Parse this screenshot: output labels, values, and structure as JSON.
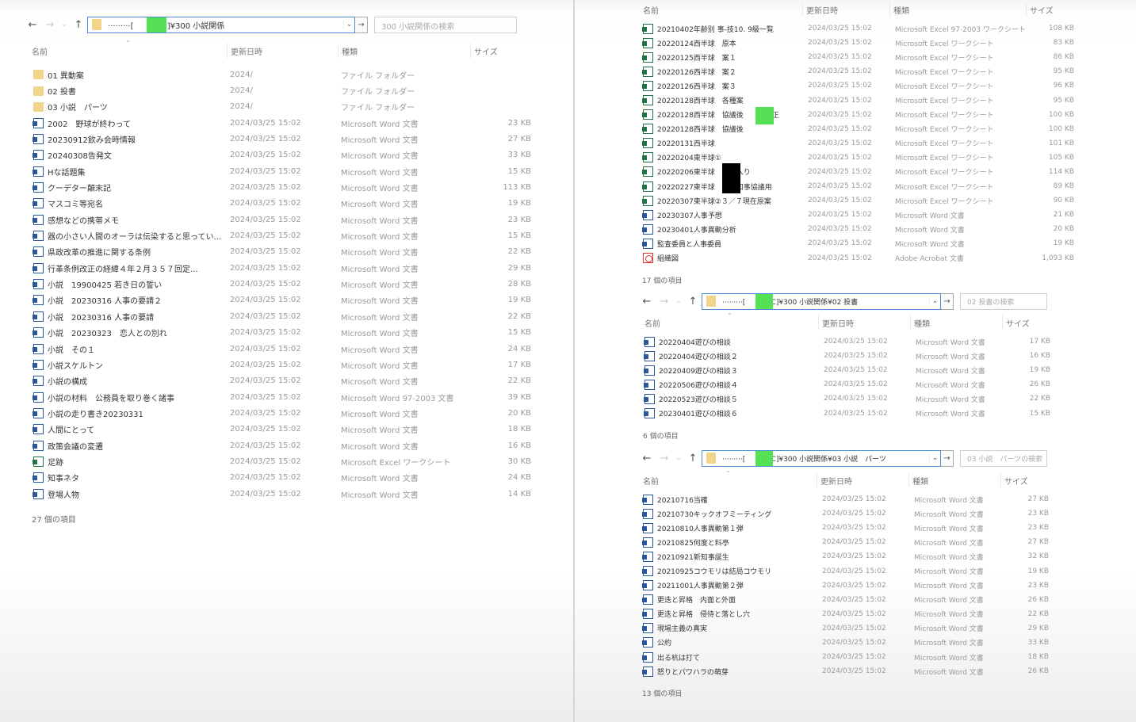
{
  "left": {
    "path_prefix": "·········[",
    "path": "P C]¥300 小説関係",
    "search_placeholder": "300 小説関係の検索",
    "headers": {
      "name": "名前",
      "date": "更新日時",
      "type": "種類",
      "size": "サイズ"
    },
    "rows": [
      {
        "icon": "folder",
        "name": "01 異動案",
        "date": "2024/",
        "type": "ファイル フォルダー",
        "size": ""
      },
      {
        "icon": "folder",
        "name": "02 投書",
        "date": "2024/",
        "type": "ファイル フォルダー",
        "size": ""
      },
      {
        "icon": "folder",
        "name": "03 小説　パーツ",
        "date": "2024/",
        "type": "ファイル フォルダー",
        "size": ""
      },
      {
        "icon": "word",
        "name": "2002　野球が終わって",
        "date": "2024/03/25 15:02",
        "type": "Microsoft Word 文書",
        "size": "23 KB"
      },
      {
        "icon": "word",
        "name": "20230912飲み会時情報",
        "date": "2024/03/25 15:02",
        "type": "Microsoft Word 文書",
        "size": "27 KB"
      },
      {
        "icon": "word",
        "name": "20240308告発文",
        "date": "2024/03/25 15:02",
        "type": "Microsoft Word 文書",
        "size": "33 KB"
      },
      {
        "icon": "word",
        "name": "Hな話題集",
        "date": "2024/03/25 15:02",
        "type": "Microsoft Word 文書",
        "size": "15 KB"
      },
      {
        "icon": "word",
        "name": "クーデター顛末記",
        "date": "2024/03/25 15:02",
        "type": "Microsoft Word 文書",
        "size": "113 KB"
      },
      {
        "icon": "word",
        "name": "マスコミ等宛名",
        "date": "2024/03/25 15:02",
        "type": "Microsoft Word 文書",
        "size": "19 KB"
      },
      {
        "icon": "word",
        "name": "感想などの携帯メモ",
        "date": "2024/03/25 15:02",
        "type": "Microsoft Word 文書",
        "size": "23 KB"
      },
      {
        "icon": "word",
        "name": "器の小さい人間のオーラは伝染すると思ってい...",
        "date": "2024/03/25 15:02",
        "type": "Microsoft Word 文書",
        "size": "15 KB"
      },
      {
        "icon": "word",
        "name": "県政改革の推進に関する条例",
        "date": "2024/03/25 15:02",
        "type": "Microsoft Word 文書",
        "size": "22 KB"
      },
      {
        "icon": "word",
        "name": "行革条例改正の経緯４年２月３５７回定...",
        "date": "2024/03/25 15:02",
        "type": "Microsoft Word 文書",
        "size": "29 KB"
      },
      {
        "icon": "word",
        "name": "小説　19900425 若き日の誓い",
        "date": "2024/03/25 15:02",
        "type": "Microsoft Word 文書",
        "size": "28 KB"
      },
      {
        "icon": "word",
        "name": "小説　20230316 人事の要請２",
        "date": "2024/03/25 15:02",
        "type": "Microsoft Word 文書",
        "size": "19 KB"
      },
      {
        "icon": "word",
        "name": "小説　20230316 人事の要請",
        "date": "2024/03/25 15:02",
        "type": "Microsoft Word 文書",
        "size": "22 KB"
      },
      {
        "icon": "word",
        "name": "小説　20230323　恋人との別れ",
        "date": "2024/03/25 15:02",
        "type": "Microsoft Word 文書",
        "size": "15 KB"
      },
      {
        "icon": "word",
        "name": "小説　その１",
        "date": "2024/03/25 15:02",
        "type": "Microsoft Word 文書",
        "size": "24 KB"
      },
      {
        "icon": "word",
        "name": "小説スケルトン",
        "date": "2024/03/25 15:02",
        "type": "Microsoft Word 文書",
        "size": "17 KB"
      },
      {
        "icon": "word",
        "name": "小説の構成",
        "date": "2024/03/25 15:02",
        "type": "Microsoft Word 文書",
        "size": "22 KB"
      },
      {
        "icon": "word",
        "name": "小説の材料　公務員を取り巻く諸事",
        "date": "2024/03/25 15:02",
        "type": "Microsoft Word 97-2003 文書",
        "size": "39 KB"
      },
      {
        "icon": "word",
        "name": "小説の走り書き20230331",
        "date": "2024/03/25 15:02",
        "type": "Microsoft Word 文書",
        "size": "20 KB"
      },
      {
        "icon": "word",
        "name": "人間にとって",
        "date": "2024/03/25 15:02",
        "type": "Microsoft Word 文書",
        "size": "18 KB"
      },
      {
        "icon": "word",
        "name": "政策会議の変遷",
        "date": "2024/03/25 15:02",
        "type": "Microsoft Word 文書",
        "size": "16 KB"
      },
      {
        "icon": "excel",
        "name": "足跡",
        "date": "2024/03/25 15:02",
        "type": "Microsoft Excel ワークシート",
        "size": "30 KB"
      },
      {
        "icon": "word",
        "name": "知事ネタ",
        "date": "2024/03/25 15:02",
        "type": "Microsoft Word 文書",
        "size": "24 KB"
      },
      {
        "icon": "word",
        "name": "登場人物",
        "date": "2024/03/25 15:02",
        "type": "Microsoft Word 文書",
        "size": "14 KB"
      }
    ],
    "count": "27 個の項目"
  },
  "r1": {
    "headers": {
      "name": "名前",
      "date": "更新日時",
      "type": "種類",
      "size": "サイズ"
    },
    "rows": [
      {
        "icon": "excel",
        "name": "20210402年齢別 事-技10. 9級一覧",
        "date": "2024/03/25 15:02",
        "type": "Microsoft Excel 97-2003 ワークシート",
        "size": "108 KB"
      },
      {
        "icon": "excel",
        "name": "20220124西半球　原本",
        "date": "2024/03/25 15:02",
        "type": "Microsoft Excel ワークシート",
        "size": "83 KB"
      },
      {
        "icon": "excel",
        "name": "20220125西半球　案１",
        "date": "2024/03/25 15:02",
        "type": "Microsoft Excel ワークシート",
        "size": "86 KB"
      },
      {
        "icon": "excel",
        "name": "20220126西半球　案２",
        "date": "2024/03/25 15:02",
        "type": "Microsoft Excel ワークシート",
        "size": "95 KB"
      },
      {
        "icon": "excel",
        "name": "20220126西半球　案３",
        "date": "2024/03/25 15:02",
        "type": "Microsoft Excel ワークシート",
        "size": "96 KB"
      },
      {
        "icon": "excel",
        "name": "20220128西半球　各種案",
        "date": "2024/03/25 15:02",
        "type": "Microsoft Excel ワークシート",
        "size": "95 KB"
      },
      {
        "icon": "excel",
        "name": "20220128西半球　協議後　　　修正",
        "date": "2024/03/25 15:02",
        "type": "Microsoft Excel ワークシート",
        "size": "100 KB"
      },
      {
        "icon": "excel",
        "name": "20220128西半球　協議後",
        "date": "2024/03/25 15:02",
        "type": "Microsoft Excel ワークシート",
        "size": "100 KB"
      },
      {
        "icon": "excel",
        "name": "20220131西半球",
        "date": "2024/03/25 15:02",
        "type": "Microsoft Excel ワークシート",
        "size": "101 KB"
      },
      {
        "icon": "excel",
        "name": "20220204東半球①",
        "date": "2024/03/25 15:02",
        "type": "Microsoft Excel ワークシート",
        "size": "105 KB"
      },
      {
        "icon": "excel",
        "name": "20220206東半球　　案入り",
        "date": "2024/03/25 15:02",
        "type": "Microsoft Excel ワークシート",
        "size": "114 KB"
      },
      {
        "icon": "excel",
        "name": "20220227東半球　　案知事協議用",
        "date": "2024/03/25 15:02",
        "type": "Microsoft Excel ワークシート",
        "size": "89 KB"
      },
      {
        "icon": "excel",
        "name": "20220307東半球②３／７現在原案",
        "date": "2024/03/25 15:02",
        "type": "Microsoft Excel ワークシート",
        "size": "90 KB"
      },
      {
        "icon": "word",
        "name": "20230307人事予想",
        "date": "2024/03/25 15:02",
        "type": "Microsoft Word 文書",
        "size": "21 KB"
      },
      {
        "icon": "word",
        "name": "20230401人事異動分析",
        "date": "2024/03/25 15:02",
        "type": "Microsoft Word 文書",
        "size": "20 KB"
      },
      {
        "icon": "word",
        "name": "監査委員と人事委員",
        "date": "2024/03/25 15:02",
        "type": "Microsoft Word 文書",
        "size": "19 KB"
      },
      {
        "icon": "pdf",
        "name": "組織図",
        "date": "2024/03/25 15:02",
        "type": "Adobe Acrobat 文書",
        "size": "1,093 KB"
      }
    ],
    "count": "17 個の項目"
  },
  "r2": {
    "path_prefix": "·········[",
    "path": "P C]¥300 小説関係¥02 投書",
    "search_placeholder": "02 投書の検索",
    "headers": {
      "name": "名前",
      "date": "更新日時",
      "type": "種類",
      "size": "サイズ"
    },
    "rows": [
      {
        "icon": "word",
        "name": "20220404遊びの相談",
        "date": "2024/03/25 15:02",
        "type": "Microsoft Word 文書",
        "size": "17 KB"
      },
      {
        "icon": "word",
        "name": "20220404遊びの相談２",
        "date": "2024/03/25 15:02",
        "type": "Microsoft Word 文書",
        "size": "16 KB"
      },
      {
        "icon": "word",
        "name": "20220409遊びの相談３",
        "date": "2024/03/25 15:02",
        "type": "Microsoft Word 文書",
        "size": "19 KB"
      },
      {
        "icon": "word",
        "name": "20220506遊びの相談４",
        "date": "2024/03/25 15:02",
        "type": "Microsoft Word 文書",
        "size": "26 KB"
      },
      {
        "icon": "word",
        "name": "20220523遊びの相談５",
        "date": "2024/03/25 15:02",
        "type": "Microsoft Word 文書",
        "size": "22 KB"
      },
      {
        "icon": "word",
        "name": "20230401遊びの相談６",
        "date": "2024/03/25 15:02",
        "type": "Microsoft Word 文書",
        "size": "15 KB"
      }
    ],
    "count": "6 個の項目"
  },
  "r3": {
    "path_prefix": "·········[",
    "path": "P C]¥300 小説関係¥03 小説　パーツ",
    "search_placeholder": "03 小説　パーツの検索",
    "headers": {
      "name": "名前",
      "date": "更新日時",
      "type": "種類",
      "size": "サイズ"
    },
    "rows": [
      {
        "icon": "word",
        "name": "20210716当確",
        "date": "2024/03/25 15:02",
        "type": "Microsoft Word 文書",
        "size": "27 KB"
      },
      {
        "icon": "word",
        "name": "20210730キックオフミーティング",
        "date": "2024/03/25 15:02",
        "type": "Microsoft Word 文書",
        "size": "23 KB"
      },
      {
        "icon": "word",
        "name": "20210810人事異動第１弾",
        "date": "2024/03/25 15:02",
        "type": "Microsoft Word 文書",
        "size": "23 KB"
      },
      {
        "icon": "word",
        "name": "20210825何度と料亭",
        "date": "2024/03/25 15:02",
        "type": "Microsoft Word 文書",
        "size": "27 KB"
      },
      {
        "icon": "word",
        "name": "20210921新知事誕生",
        "date": "2024/03/25 15:02",
        "type": "Microsoft Word 文書",
        "size": "32 KB"
      },
      {
        "icon": "word",
        "name": "20210925コウモリは結局コウモリ",
        "date": "2024/03/25 15:02",
        "type": "Microsoft Word 文書",
        "size": "19 KB"
      },
      {
        "icon": "word",
        "name": "20211001人事異動第２弾",
        "date": "2024/03/25 15:02",
        "type": "Microsoft Word 文書",
        "size": "23 KB"
      },
      {
        "icon": "word",
        "name": "更迭と昇格　内面と外面",
        "date": "2024/03/25 15:02",
        "type": "Microsoft Word 文書",
        "size": "26 KB"
      },
      {
        "icon": "word",
        "name": "更迭と昇格　侵待と落とし穴",
        "date": "2024/03/25 15:02",
        "type": "Microsoft Word 文書",
        "size": "22 KB"
      },
      {
        "icon": "word",
        "name": "現場主義の真実",
        "date": "2024/03/25 15:02",
        "type": "Microsoft Word 文書",
        "size": "29 KB"
      },
      {
        "icon": "word",
        "name": "公約",
        "date": "2024/03/25 15:02",
        "type": "Microsoft Word 文書",
        "size": "33 KB"
      },
      {
        "icon": "word",
        "name": "出る杭は打て",
        "date": "2024/03/25 15:02",
        "type": "Microsoft Word 文書",
        "size": "18 KB"
      },
      {
        "icon": "word",
        "name": "怒りとパワハラの萌芽",
        "date": "2024/03/25 15:02",
        "type": "Microsoft Word 文書",
        "size": "26 KB"
      }
    ],
    "count": "13 個の項目"
  }
}
